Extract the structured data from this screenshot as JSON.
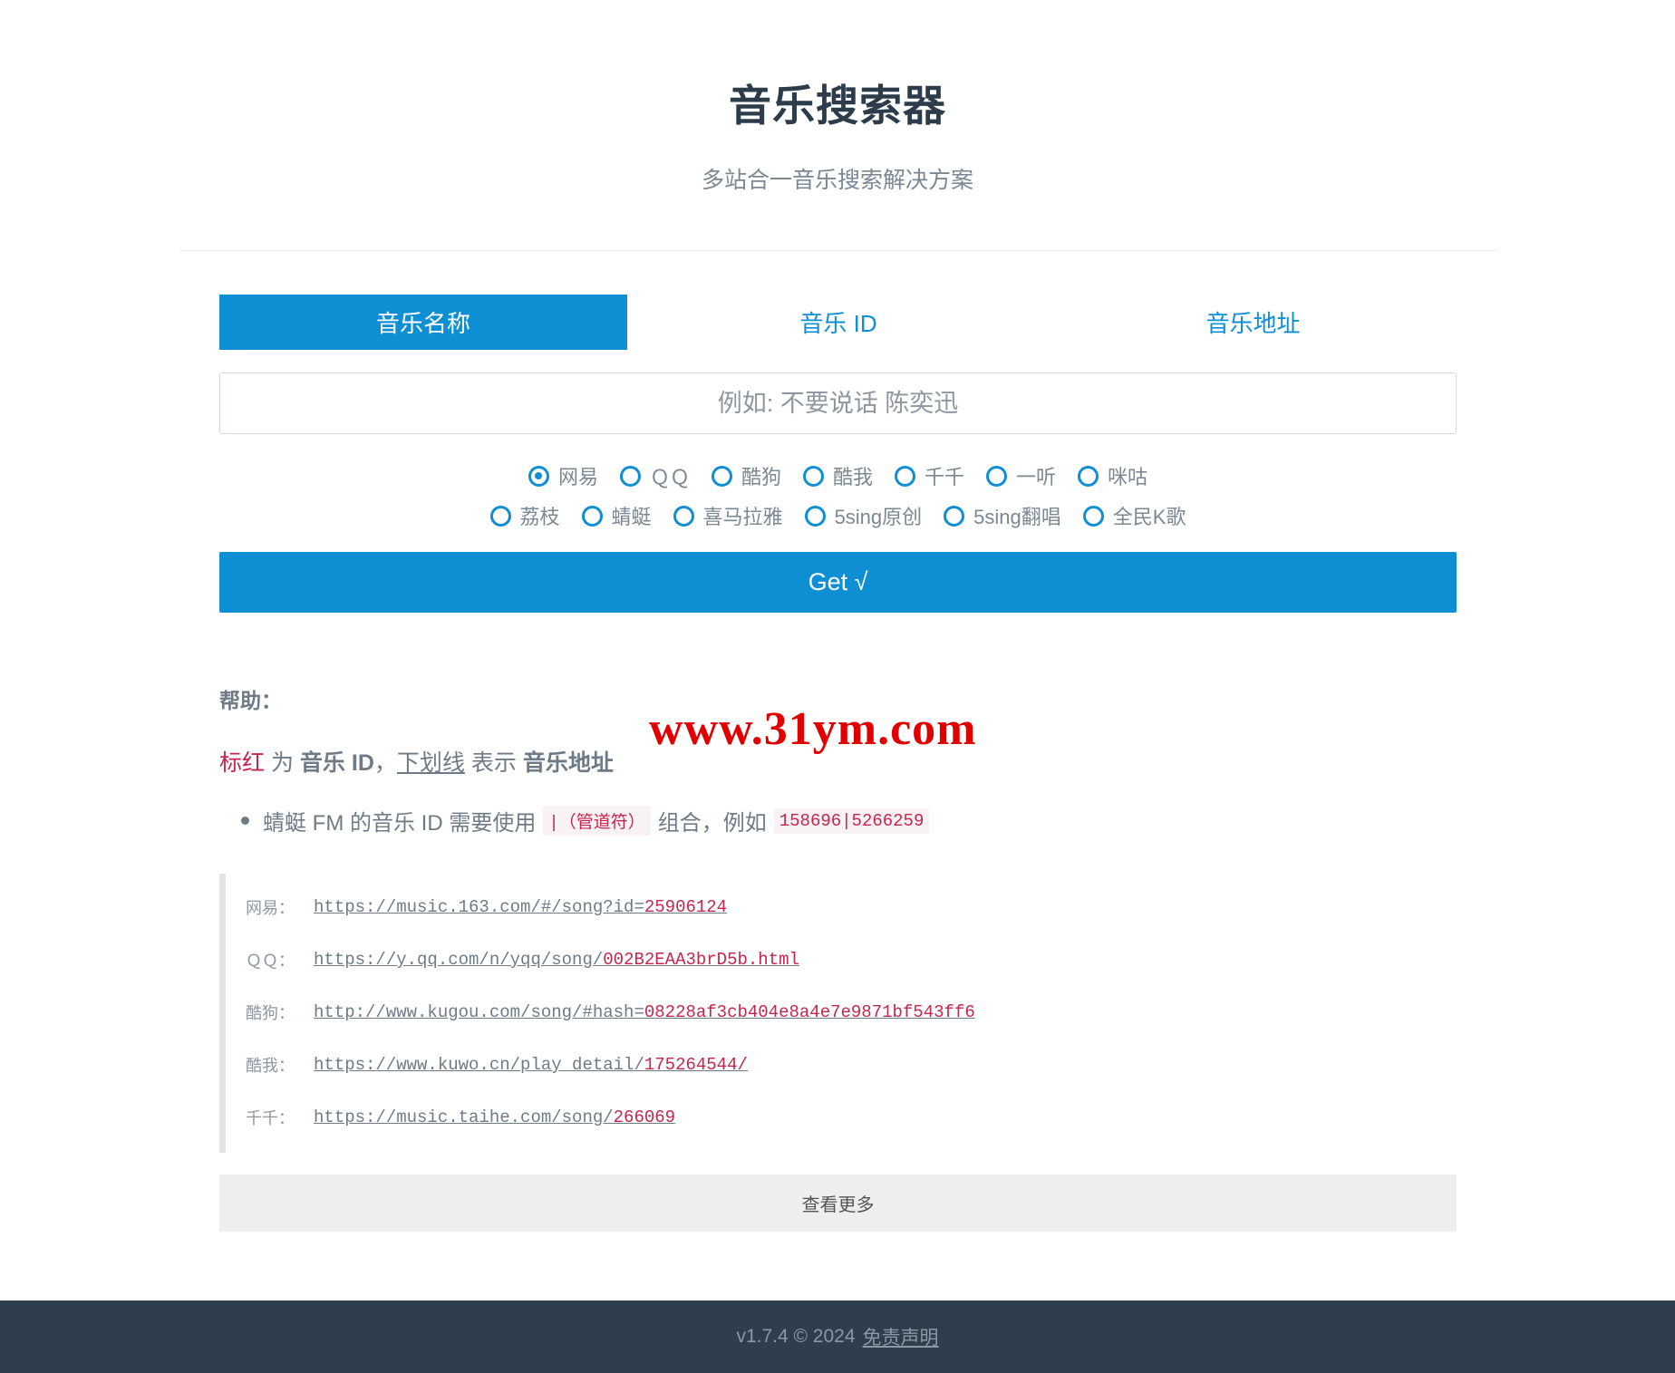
{
  "header": {
    "title": "音乐搜索器",
    "subtitle": "多站合一音乐搜索解决方案"
  },
  "tabs": [
    {
      "label": "音乐名称",
      "active": true
    },
    {
      "label": "音乐 ID",
      "active": false
    },
    {
      "label": "音乐地址",
      "active": false
    }
  ],
  "search": {
    "placeholder": "例如: 不要说话 陈奕迅",
    "value": ""
  },
  "sources": {
    "row1": [
      "网易",
      "ＱＱ",
      "酷狗",
      "酷我",
      "千千",
      "一听",
      "咪咕"
    ],
    "row2": [
      "荔枝",
      "蜻蜓",
      "喜马拉雅",
      "5sing原创",
      "5sing翻唱",
      "全民K歌"
    ],
    "selected": "网易"
  },
  "get_button": "Get √",
  "help": {
    "title": "帮助：",
    "legend": {
      "red": "标红",
      "part1": " 为 ",
      "bold1": "音乐 ID",
      "part2": "，",
      "underline": "下划线",
      "part3": " 表示 ",
      "bold2": "音乐地址"
    },
    "note": {
      "text1": "蜻蜓 FM 的音乐 ID 需要使用",
      "code1": "|（管道符）",
      "text2": "组合，例如",
      "code2": "158696|5266259"
    }
  },
  "watermark": "www.31ym.com",
  "examples": [
    {
      "label": "网易：",
      "prefix": "https://music.163.com/#/song?id=",
      "id": "25906124",
      "suffix": ""
    },
    {
      "label": "ＱＱ：",
      "prefix": "https://y.qq.com/n/yqq/song/",
      "id": "002B2EAA3brD5b",
      "suffix": ".html"
    },
    {
      "label": "酷狗：",
      "prefix": "http://www.kugou.com/song/#hash=",
      "id": "08228af3cb404e8a4e7e9871bf543ff6",
      "suffix": ""
    },
    {
      "label": "酷我：",
      "prefix": "https://www.kuwo.cn/play_detail/",
      "id": "175264544",
      "suffix": "/"
    },
    {
      "label": "千千：",
      "prefix": "https://music.taihe.com/song/",
      "id": "266069",
      "suffix": ""
    }
  ],
  "more_button": "查看更多",
  "footer": {
    "text": "v1.7.4 © 2024",
    "link": "免责声明"
  },
  "colors": {
    "accent": "#0f8fd3",
    "highlight": "#c7254e",
    "footer_bg": "#2e3e4e"
  }
}
